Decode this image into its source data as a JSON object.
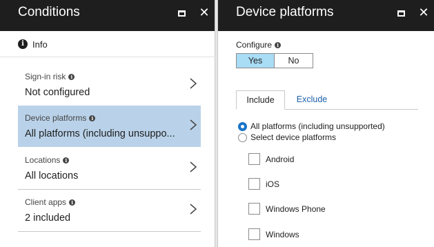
{
  "left_panel": {
    "title": "Conditions",
    "info_label": "Info",
    "items": [
      {
        "label": "Sign-in risk",
        "value": "Not configured",
        "selected": false
      },
      {
        "label": "Device platforms",
        "value": "All platforms (including unsuppo...",
        "selected": true
      },
      {
        "label": "Locations",
        "value": "All locations",
        "selected": false
      },
      {
        "label": "Client apps",
        "value": "2 included",
        "selected": false
      }
    ]
  },
  "right_panel": {
    "title": "Device platforms",
    "configure_label": "Configure",
    "toggle": {
      "yes": "Yes",
      "no": "No",
      "selected": "yes"
    },
    "tabs": {
      "include": "Include",
      "exclude": "Exclude",
      "active": "include"
    },
    "radios": [
      {
        "label": "All platforms (including unsupported)",
        "checked": true
      },
      {
        "label": "Select device platforms",
        "checked": false
      }
    ],
    "platforms": [
      {
        "label": "Android",
        "checked": false
      },
      {
        "label": "iOS",
        "checked": false
      },
      {
        "label": "Windows Phone",
        "checked": false
      },
      {
        "label": "Windows",
        "checked": false
      }
    ]
  },
  "icons": {
    "info": "info-icon",
    "maximize": "maximize-icon",
    "close": "close-icon",
    "chevron": "chevron-right-icon"
  },
  "colors": {
    "header_bg": "#1e1e1e",
    "selected_item_bg": "#b9d2e9",
    "toggle_on_bg": "#a9dcf5",
    "link_blue": "#1a5fa8",
    "radio_blue": "#1a73c8"
  }
}
